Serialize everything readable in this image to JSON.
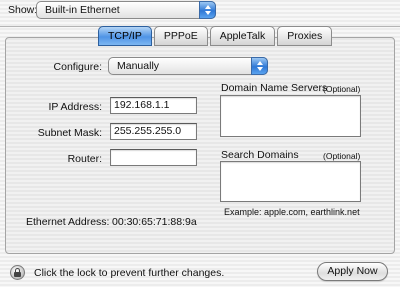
{
  "show": {
    "label": "Show:",
    "value": "Built-in Ethernet"
  },
  "tabs": [
    {
      "label": "TCP/IP",
      "active": true
    },
    {
      "label": "PPPoE",
      "active": false
    },
    {
      "label": "AppleTalk",
      "active": false
    },
    {
      "label": "Proxies",
      "active": false
    }
  ],
  "configure": {
    "label": "Configure:",
    "value": "Manually"
  },
  "ip": {
    "label": "IP Address:",
    "value": "192.168.1.1"
  },
  "subnet": {
    "label": "Subnet Mask:",
    "value": "255.255.255.0"
  },
  "router": {
    "label": "Router:",
    "value": ""
  },
  "dns": {
    "label": "Domain Name Servers",
    "optional": "(Optional)"
  },
  "search": {
    "label": "Search Domains",
    "optional": "(Optional)",
    "example": "Example: apple.com, earthlink.net"
  },
  "ethernet": {
    "label": "Ethernet Address:",
    "value": "00:30:65:71:88:9a"
  },
  "footer": {
    "lock_text": "Click the lock to prevent further changes.",
    "apply_label": "Apply Now"
  },
  "colors": {
    "tab_active": "#4f94e6",
    "popup_button": "#2f78d6"
  }
}
